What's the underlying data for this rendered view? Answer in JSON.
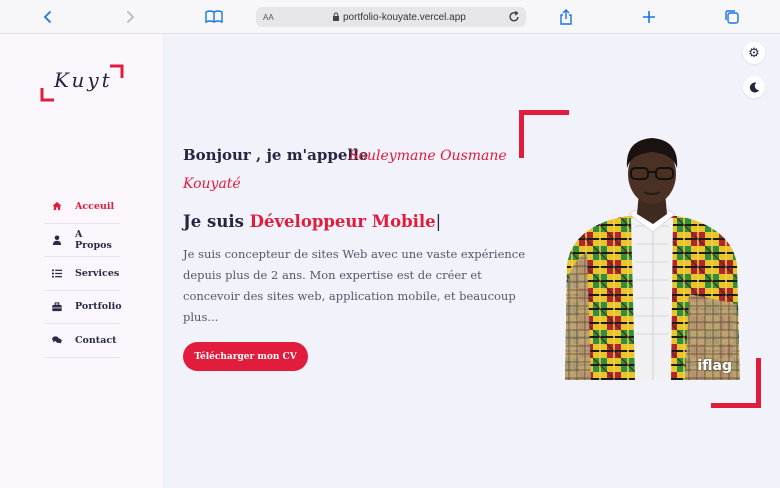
{
  "browser": {
    "text_size_label": "AA",
    "url": "portfolio-kouyate.vercel.app"
  },
  "logo": {
    "text": "Kuyt"
  },
  "nav": {
    "items": [
      {
        "label": "Acceuil",
        "icon": "home-icon",
        "active": true
      },
      {
        "label": "A Propos",
        "icon": "user-icon",
        "active": false
      },
      {
        "label": "Services",
        "icon": "list-icon",
        "active": false
      },
      {
        "label": "Portfolio",
        "icon": "briefcase-icon",
        "active": false
      },
      {
        "label": "Contact",
        "icon": "chat-icon",
        "active": false
      }
    ]
  },
  "hero": {
    "greeting": "Bonjour , je m'appelle",
    "name_line1": "Souleymane Ousmane",
    "name_line2": "Kouyaté",
    "role_prefix": "Je suis",
    "role_highlight": "Développeur Mobile",
    "role_cursor": "|",
    "description": "Je suis concepteur de sites Web avec une vaste expérience depuis plus de 2 ans. Mon expertise est de créer et concevoir des sites web, application mobile, et beaucoup plus...",
    "cv_button": "Télécharger mon CV"
  },
  "photo": {
    "watermark": "iflag"
  },
  "colors": {
    "accent": "#e21c3c",
    "text_dark": "#262640",
    "background": "#f2f2fb",
    "sidebar_bg": "#fcf6fd"
  }
}
